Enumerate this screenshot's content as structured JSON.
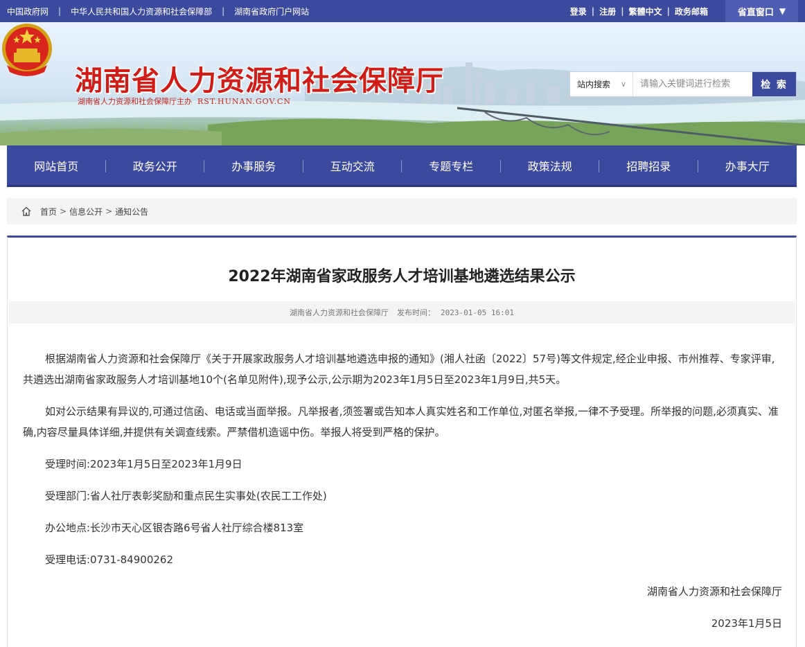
{
  "topbar": {
    "links": [
      "中国政府网",
      "中华人民共和国人力资源和社会保障部",
      "湖南省政府门户网站"
    ],
    "account": [
      "登录",
      "注册",
      "繁體中文",
      "政务邮箱"
    ],
    "province_window": "省直窗口"
  },
  "header": {
    "site_title": "湖南省人力资源和社会保障厅",
    "site_subtitle": "湖南省人力资源和社会保障厅主办",
    "domain": "RST.HUNAN.GOV.CN"
  },
  "search": {
    "scope": "站内搜索",
    "placeholder": "请输入关键词进行检索",
    "button": "检 索"
  },
  "nav": {
    "items": [
      "网站首页",
      "政务公开",
      "办事服务",
      "互动交流",
      "专题专栏",
      "政策法规",
      "招聘招录",
      "办事大厅"
    ]
  },
  "breadcrumb": {
    "items": [
      "首页",
      "信息公开",
      "通知公告"
    ]
  },
  "article": {
    "title": "2022年湖南省家政服务人才培训基地遴选结果公示",
    "source": "湖南省人力资源和社会保障厅",
    "time_label": "发布时间：",
    "time": "2023-01-05 16:01",
    "paragraph1": "根据湖南省人力资源和社会保障厅《关于开展家政服务人才培训基地遴选申报的通知》(湘人社函〔2022〕57号)等文件规定,经企业申报、市州推荐、专家评审,共遴选出湖南省家政服务人才培训基地10个(名单见附件),现予公示,公示期为2023年1月5日至2023年1月9日,共5天。",
    "paragraph2": "如对公示结果有异议的,可通过信函、电话或当面举报。凡举报者,须签署或告知本人真实姓名和工作单位,对匿名举报,一律不予受理。所举报的问题,必须真实、准确,内容尽量具体详细,并提供有关调查线索。严禁借机造谣中伤。举报人将受到严格的保护。",
    "line_time": "受理时间:2023年1月5日至2023年1月9日",
    "line_dept": "受理部门:省人社厅表彰奖励和重点民生实事处(农民工工作处)",
    "line_addr": "办公地点:长沙市天心区银杏路6号省人社厅综合楼813室",
    "line_phone": "受理电话:0731-84900262",
    "signature": "湖南省人力资源和社会保障厅",
    "date": "2023年1月5日"
  },
  "colors": {
    "primary": "#3c4a9d",
    "title_red": "#d01d17"
  }
}
